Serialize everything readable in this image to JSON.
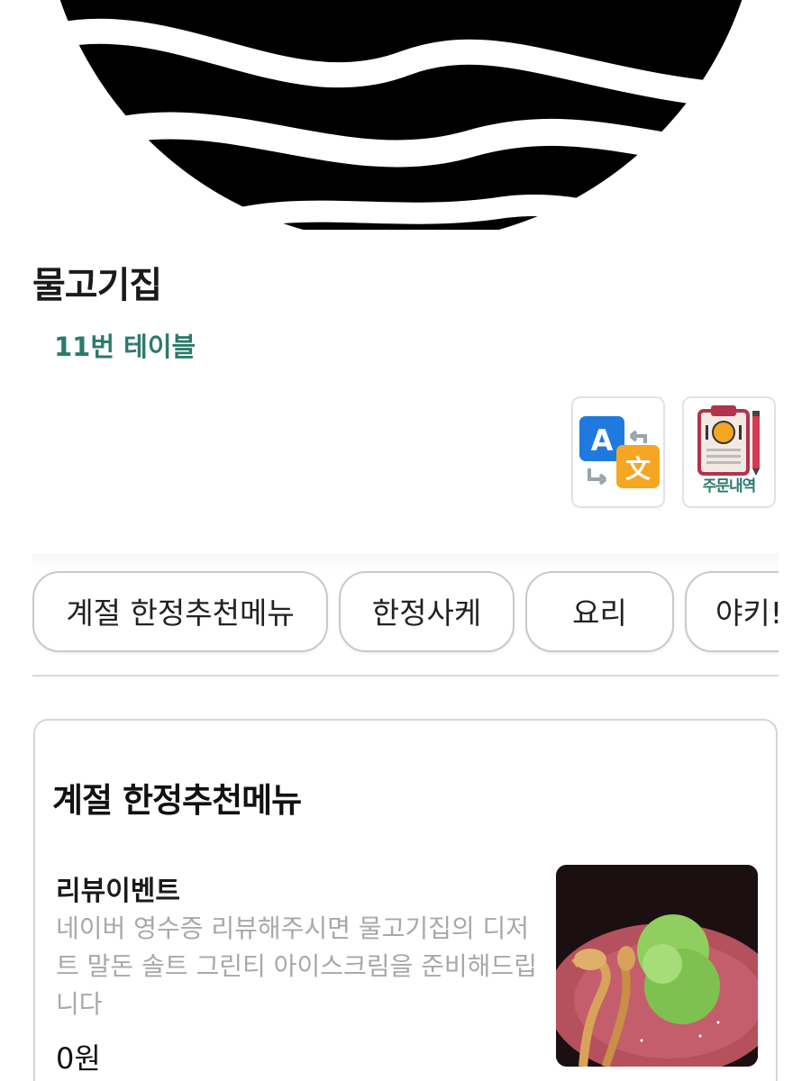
{
  "store": {
    "name": "물고기집",
    "table_label": "11번 테이블"
  },
  "actions": {
    "translate_icon": "translate-icon",
    "orders_label": "주문내역"
  },
  "categories": [
    {
      "label": "계절 한정추천메뉴"
    },
    {
      "label": "한정사케"
    },
    {
      "label": "요리"
    },
    {
      "label": "야키!"
    }
  ],
  "section": {
    "title": "계절 한정추천메뉴",
    "items": [
      {
        "name": "리뷰이벤트",
        "description": "네이버 영수증 리뷰해주시면 물고기집의 디저트 말돈 솔트 그린티 아이스크림을 준비해드립니다",
        "price": "0원"
      }
    ]
  },
  "colors": {
    "accent": "#2b7a6d",
    "border": "#c9c9c9",
    "muted_text": "#a8a8a8"
  }
}
